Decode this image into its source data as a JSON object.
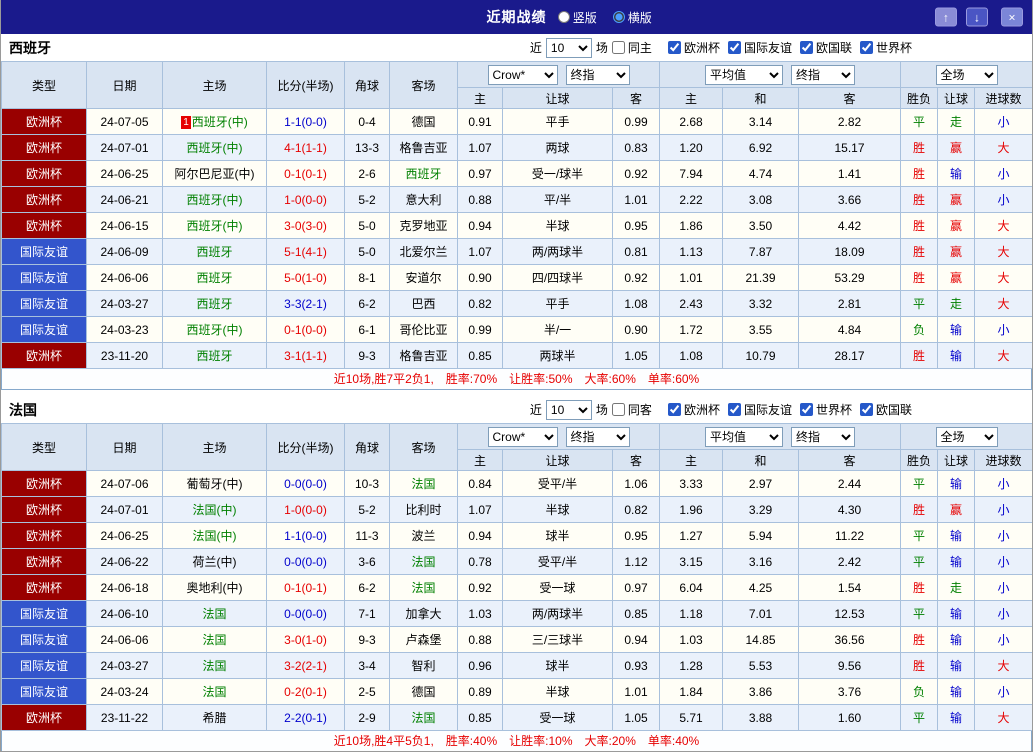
{
  "titlebar": {
    "title": "近期战绩",
    "layout_options": [
      {
        "label": "竖版",
        "selected": false
      },
      {
        "label": "横版",
        "selected": true
      }
    ],
    "up_icon": "↑",
    "down_icon": "↓",
    "close_icon": "×"
  },
  "table_header": {
    "type": "类型",
    "date": "日期",
    "home": "主场",
    "score": "比分(半场)",
    "corner": "角球",
    "away": "客场",
    "asian_select": "Crow*",
    "asian_final_select": "终指",
    "euro_select": "平均值",
    "euro_final_select": "终指",
    "scope_select": "全场",
    "asian_home": "主",
    "asian_handicap": "让球",
    "asian_away": "客",
    "euro_home": "主",
    "euro_draw": "和",
    "euro_away": "客",
    "outcome": "胜负",
    "handicap_outcome": "让球",
    "goals": "进球数"
  },
  "sections": [
    {
      "team": "西班牙",
      "filter": {
        "near": "近",
        "count": "10",
        "unit": "场",
        "venue_label": "同主",
        "venue_checked": false,
        "competitions": [
          {
            "label": "欧洲杯",
            "checked": true
          },
          {
            "label": "国际友谊",
            "checked": true
          },
          {
            "label": "欧国联",
            "checked": true
          },
          {
            "label": "世界杯",
            "checked": true
          }
        ]
      },
      "rows": [
        {
          "type": "欧洲杯",
          "league_color": "#990000",
          "date": "24-07-05",
          "home": "西班牙(中)",
          "home_color": "#008000",
          "home_badge": "1",
          "score": "1-1(0-0)",
          "score_color": "#0000cc",
          "corner": "0-4",
          "away": "德国",
          "away_color": "#000000",
          "ah_home": "0.91",
          "handicap": "平手",
          "ah_away": "0.99",
          "eu_home": "2.68",
          "eu_draw": "3.14",
          "eu_away": "2.82",
          "result": "平",
          "result_color": "#008000",
          "handicap_result": "走",
          "handicap_result_color": "#008000",
          "goals": "小",
          "goals_color": "#0000cc"
        },
        {
          "type": "欧洲杯",
          "league_color": "#990000",
          "date": "24-07-01",
          "home": "西班牙(中)",
          "home_color": "#008000",
          "home_badge": "",
          "score": "4-1(1-1)",
          "score_color": "#e60000",
          "corner": "13-3",
          "away": "格鲁吉亚",
          "away_color": "#000000",
          "ah_home": "1.07",
          "handicap": "两球",
          "ah_away": "0.83",
          "eu_home": "1.20",
          "eu_draw": "6.92",
          "eu_away": "15.17",
          "result": "胜",
          "result_color": "#e60000",
          "handicap_result": "赢",
          "handicap_result_color": "#e60000",
          "goals": "大",
          "goals_color": "#e60000"
        },
        {
          "type": "欧洲杯",
          "league_color": "#990000",
          "date": "24-06-25",
          "home": "阿尔巴尼亚(中)",
          "home_color": "#000000",
          "home_badge": "",
          "score": "0-1(0-1)",
          "score_color": "#e60000",
          "corner": "2-6",
          "away": "西班牙",
          "away_color": "#008000",
          "ah_home": "0.97",
          "handicap": "受一/球半",
          "ah_away": "0.92",
          "eu_home": "7.94",
          "eu_draw": "4.74",
          "eu_away": "1.41",
          "result": "胜",
          "result_color": "#e60000",
          "handicap_result": "输",
          "handicap_result_color": "#0000cc",
          "goals": "小",
          "goals_color": "#0000cc"
        },
        {
          "type": "欧洲杯",
          "league_color": "#990000",
          "date": "24-06-21",
          "home": "西班牙(中)",
          "home_color": "#008000",
          "home_badge": "",
          "score": "1-0(0-0)",
          "score_color": "#e60000",
          "corner": "5-2",
          "away": "意大利",
          "away_color": "#000000",
          "ah_home": "0.88",
          "handicap": "平/半",
          "ah_away": "1.01",
          "eu_home": "2.22",
          "eu_draw": "3.08",
          "eu_away": "3.66",
          "result": "胜",
          "result_color": "#e60000",
          "handicap_result": "赢",
          "handicap_result_color": "#e60000",
          "goals": "小",
          "goals_color": "#0000cc"
        },
        {
          "type": "欧洲杯",
          "league_color": "#990000",
          "date": "24-06-15",
          "home": "西班牙(中)",
          "home_color": "#008000",
          "home_badge": "",
          "score": "3-0(3-0)",
          "score_color": "#e60000",
          "corner": "5-0",
          "away": "克罗地亚",
          "away_color": "#000000",
          "ah_home": "0.94",
          "handicap": "半球",
          "ah_away": "0.95",
          "eu_home": "1.86",
          "eu_draw": "3.50",
          "eu_away": "4.42",
          "result": "胜",
          "result_color": "#e60000",
          "handicap_result": "赢",
          "handicap_result_color": "#e60000",
          "goals": "大",
          "goals_color": "#e60000"
        },
        {
          "type": "国际友谊",
          "league_color": "#3355cc",
          "date": "24-06-09",
          "home": "西班牙",
          "home_color": "#008000",
          "home_badge": "",
          "score": "5-1(4-1)",
          "score_color": "#e60000",
          "corner": "5-0",
          "away": "北爱尔兰",
          "away_color": "#000000",
          "ah_home": "1.07",
          "handicap": "两/两球半",
          "ah_away": "0.81",
          "eu_home": "1.13",
          "eu_draw": "7.87",
          "eu_away": "18.09",
          "result": "胜",
          "result_color": "#e60000",
          "handicap_result": "赢",
          "handicap_result_color": "#e60000",
          "goals": "大",
          "goals_color": "#e60000"
        },
        {
          "type": "国际友谊",
          "league_color": "#3355cc",
          "date": "24-06-06",
          "home": "西班牙",
          "home_color": "#008000",
          "home_badge": "",
          "score": "5-0(1-0)",
          "score_color": "#e60000",
          "corner": "8-1",
          "away": "安道尔",
          "away_color": "#000000",
          "ah_home": "0.90",
          "handicap": "四/四球半",
          "ah_away": "0.92",
          "eu_home": "1.01",
          "eu_draw": "21.39",
          "eu_away": "53.29",
          "result": "胜",
          "result_color": "#e60000",
          "handicap_result": "赢",
          "handicap_result_color": "#e60000",
          "goals": "大",
          "goals_color": "#e60000"
        },
        {
          "type": "国际友谊",
          "league_color": "#3355cc",
          "date": "24-03-27",
          "home": "西班牙",
          "home_color": "#008000",
          "home_badge": "",
          "score": "3-3(2-1)",
          "score_color": "#0000cc",
          "corner": "6-2",
          "away": "巴西",
          "away_color": "#000000",
          "ah_home": "0.82",
          "handicap": "平手",
          "ah_away": "1.08",
          "eu_home": "2.43",
          "eu_draw": "3.32",
          "eu_away": "2.81",
          "result": "平",
          "result_color": "#008000",
          "handicap_result": "走",
          "handicap_result_color": "#008000",
          "goals": "大",
          "goals_color": "#e60000"
        },
        {
          "type": "国际友谊",
          "league_color": "#3355cc",
          "date": "24-03-23",
          "home": "西班牙(中)",
          "home_color": "#008000",
          "home_badge": "",
          "score": "0-1(0-0)",
          "score_color": "#e60000",
          "corner": "6-1",
          "away": "哥伦比亚",
          "away_color": "#000000",
          "ah_home": "0.99",
          "handicap": "半/一",
          "ah_away": "0.90",
          "eu_home": "1.72",
          "eu_draw": "3.55",
          "eu_away": "4.84",
          "result": "负",
          "result_color": "#008000",
          "handicap_result": "输",
          "handicap_result_color": "#0000cc",
          "goals": "小",
          "goals_color": "#0000cc"
        },
        {
          "type": "欧洲杯",
          "league_color": "#990000",
          "date": "23-11-20",
          "home": "西班牙",
          "home_color": "#008000",
          "home_badge": "",
          "score": "3-1(1-1)",
          "score_color": "#e60000",
          "corner": "9-3",
          "away": "格鲁吉亚",
          "away_color": "#000000",
          "ah_home": "0.85",
          "handicap": "两球半",
          "ah_away": "1.05",
          "eu_home": "1.08",
          "eu_draw": "10.79",
          "eu_away": "28.17",
          "result": "胜",
          "result_color": "#e60000",
          "handicap_result": "输",
          "handicap_result_color": "#0000cc",
          "goals": "大",
          "goals_color": "#e60000"
        }
      ],
      "summary": [
        {
          "text": "近10场,胜7平2负1,",
          "color": "#e60000"
        },
        {
          "text": "胜率:70%",
          "color": "#e60000"
        },
        {
          "text": "让胜率:50%",
          "color": "#e60000"
        },
        {
          "text": "大率:60%",
          "color": "#e60000"
        },
        {
          "text": "单率:60%",
          "color": "#e60000"
        }
      ]
    },
    {
      "team": "法国",
      "filter": {
        "near": "近",
        "count": "10",
        "unit": "场",
        "venue_label": "同客",
        "venue_checked": false,
        "competitions": [
          {
            "label": "欧洲杯",
            "checked": true
          },
          {
            "label": "国际友谊",
            "checked": true
          },
          {
            "label": "世界杯",
            "checked": true
          },
          {
            "label": "欧国联",
            "checked": true
          }
        ]
      },
      "rows": [
        {
          "type": "欧洲杯",
          "league_color": "#990000",
          "date": "24-07-06",
          "home": "葡萄牙(中)",
          "home_color": "#000000",
          "home_badge": "",
          "score": "0-0(0-0)",
          "score_color": "#0000cc",
          "corner": "10-3",
          "away": "法国",
          "away_color": "#008000",
          "ah_home": "0.84",
          "handicap": "受平/半",
          "ah_away": "1.06",
          "eu_home": "3.33",
          "eu_draw": "2.97",
          "eu_away": "2.44",
          "result": "平",
          "result_color": "#008000",
          "handicap_result": "输",
          "handicap_result_color": "#0000cc",
          "goals": "小",
          "goals_color": "#0000cc"
        },
        {
          "type": "欧洲杯",
          "league_color": "#990000",
          "date": "24-07-01",
          "home": "法国(中)",
          "home_color": "#008000",
          "home_badge": "",
          "score": "1-0(0-0)",
          "score_color": "#e60000",
          "corner": "5-2",
          "away": "比利时",
          "away_color": "#000000",
          "ah_home": "1.07",
          "handicap": "半球",
          "ah_away": "0.82",
          "eu_home": "1.96",
          "eu_draw": "3.29",
          "eu_away": "4.30",
          "result": "胜",
          "result_color": "#e60000",
          "handicap_result": "赢",
          "handicap_result_color": "#e60000",
          "goals": "小",
          "goals_color": "#0000cc"
        },
        {
          "type": "欧洲杯",
          "league_color": "#990000",
          "date": "24-06-25",
          "home": "法国(中)",
          "home_color": "#008000",
          "home_badge": "",
          "score": "1-1(0-0)",
          "score_color": "#0000cc",
          "corner": "11-3",
          "away": "波兰",
          "away_color": "#000000",
          "ah_home": "0.94",
          "handicap": "球半",
          "ah_away": "0.95",
          "eu_home": "1.27",
          "eu_draw": "5.94",
          "eu_away": "11.22",
          "result": "平",
          "result_color": "#008000",
          "handicap_result": "输",
          "handicap_result_color": "#0000cc",
          "goals": "小",
          "goals_color": "#0000cc"
        },
        {
          "type": "欧洲杯",
          "league_color": "#990000",
          "date": "24-06-22",
          "home": "荷兰(中)",
          "home_color": "#000000",
          "home_badge": "",
          "score": "0-0(0-0)",
          "score_color": "#0000cc",
          "corner": "3-6",
          "away": "法国",
          "away_color": "#008000",
          "ah_home": "0.78",
          "handicap": "受平/半",
          "ah_away": "1.12",
          "eu_home": "3.15",
          "eu_draw": "3.16",
          "eu_away": "2.42",
          "result": "平",
          "result_color": "#008000",
          "handicap_result": "输",
          "handicap_result_color": "#0000cc",
          "goals": "小",
          "goals_color": "#0000cc"
        },
        {
          "type": "欧洲杯",
          "league_color": "#990000",
          "date": "24-06-18",
          "home": "奥地利(中)",
          "home_color": "#000000",
          "home_badge": "",
          "score": "0-1(0-1)",
          "score_color": "#e60000",
          "corner": "6-2",
          "away": "法国",
          "away_color": "#008000",
          "ah_home": "0.92",
          "handicap": "受一球",
          "ah_away": "0.97",
          "eu_home": "6.04",
          "eu_draw": "4.25",
          "eu_away": "1.54",
          "result": "胜",
          "result_color": "#e60000",
          "handicap_result": "走",
          "handicap_result_color": "#008000",
          "goals": "小",
          "goals_color": "#0000cc"
        },
        {
          "type": "国际友谊",
          "league_color": "#3355cc",
          "date": "24-06-10",
          "home": "法国",
          "home_color": "#008000",
          "home_badge": "",
          "score": "0-0(0-0)",
          "score_color": "#0000cc",
          "corner": "7-1",
          "away": "加拿大",
          "away_color": "#000000",
          "ah_home": "1.03",
          "handicap": "两/两球半",
          "ah_away": "0.85",
          "eu_home": "1.18",
          "eu_draw": "7.01",
          "eu_away": "12.53",
          "result": "平",
          "result_color": "#008000",
          "handicap_result": "输",
          "handicap_result_color": "#0000cc",
          "goals": "小",
          "goals_color": "#0000cc"
        },
        {
          "type": "国际友谊",
          "league_color": "#3355cc",
          "date": "24-06-06",
          "home": "法国",
          "home_color": "#008000",
          "home_badge": "",
          "score": "3-0(1-0)",
          "score_color": "#e60000",
          "corner": "9-3",
          "away": "卢森堡",
          "away_color": "#000000",
          "ah_home": "0.88",
          "handicap": "三/三球半",
          "ah_away": "0.94",
          "eu_home": "1.03",
          "eu_draw": "14.85",
          "eu_away": "36.56",
          "result": "胜",
          "result_color": "#e60000",
          "handicap_result": "输",
          "handicap_result_color": "#0000cc",
          "goals": "小",
          "goals_color": "#0000cc"
        },
        {
          "type": "国际友谊",
          "league_color": "#3355cc",
          "date": "24-03-27",
          "home": "法国",
          "home_color": "#008000",
          "home_badge": "",
          "score": "3-2(2-1)",
          "score_color": "#e60000",
          "corner": "3-4",
          "away": "智利",
          "away_color": "#000000",
          "ah_home": "0.96",
          "handicap": "球半",
          "ah_away": "0.93",
          "eu_home": "1.28",
          "eu_draw": "5.53",
          "eu_away": "9.56",
          "result": "胜",
          "result_color": "#e60000",
          "handicap_result": "输",
          "handicap_result_color": "#0000cc",
          "goals": "大",
          "goals_color": "#e60000"
        },
        {
          "type": "国际友谊",
          "league_color": "#3355cc",
          "date": "24-03-24",
          "home": "法国",
          "home_color": "#008000",
          "home_badge": "",
          "score": "0-2(0-1)",
          "score_color": "#e60000",
          "corner": "2-5",
          "away": "德国",
          "away_color": "#000000",
          "ah_home": "0.89",
          "handicap": "半球",
          "ah_away": "1.01",
          "eu_home": "1.84",
          "eu_draw": "3.86",
          "eu_away": "3.76",
          "result": "负",
          "result_color": "#008000",
          "handicap_result": "输",
          "handicap_result_color": "#0000cc",
          "goals": "小",
          "goals_color": "#0000cc"
        },
        {
          "type": "欧洲杯",
          "league_color": "#990000",
          "date": "23-11-22",
          "home": "希腊",
          "home_color": "#000000",
          "home_badge": "",
          "score": "2-2(0-1)",
          "score_color": "#0000cc",
          "corner": "2-9",
          "away": "法国",
          "away_color": "#008000",
          "ah_home": "0.85",
          "handicap": "受一球",
          "ah_away": "1.05",
          "eu_home": "5.71",
          "eu_draw": "3.88",
          "eu_away": "1.60",
          "result": "平",
          "result_color": "#008000",
          "handicap_result": "输",
          "handicap_result_color": "#0000cc",
          "goals": "大",
          "goals_color": "#e60000"
        }
      ],
      "summary": [
        {
          "text": "近10场,胜4平5负1,",
          "color": "#e60000"
        },
        {
          "text": "胜率:40%",
          "color": "#e60000"
        },
        {
          "text": "让胜率:10%",
          "color": "#e60000"
        },
        {
          "text": "大率:20%",
          "color": "#e60000"
        },
        {
          "text": "单率:40%",
          "color": "#e60000"
        }
      ]
    }
  ]
}
